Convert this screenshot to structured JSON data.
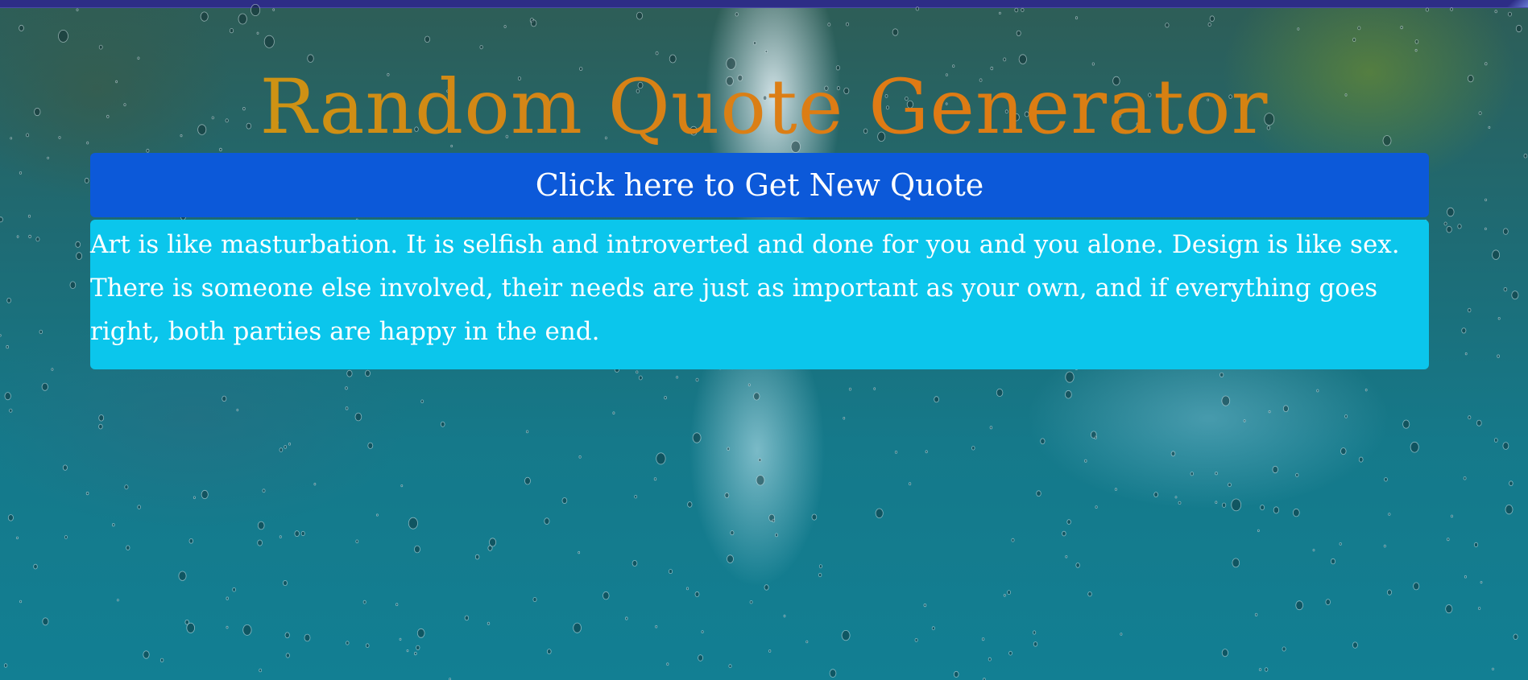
{
  "page": {
    "title": "Random Quote Generator"
  },
  "controls": {
    "new_quote_label": "Click here to Get New Quote"
  },
  "quote": {
    "text": "Art is like masturbation. It is selfish and introverted and done for you and you alone. Design is like sex. There is someone else involved, their needs are just as important as your own, and if everything goes right, both parties are happy in the end."
  },
  "colors": {
    "top_bar": "#2d2d86",
    "button_bg": "#0c59d9",
    "quote_bg": "#0bc6ec",
    "title_gradient_start": "#c7a012",
    "title_gradient_end": "#e07a14",
    "text": "#ffffff"
  },
  "background": {
    "icon": "rain-window-photo"
  }
}
